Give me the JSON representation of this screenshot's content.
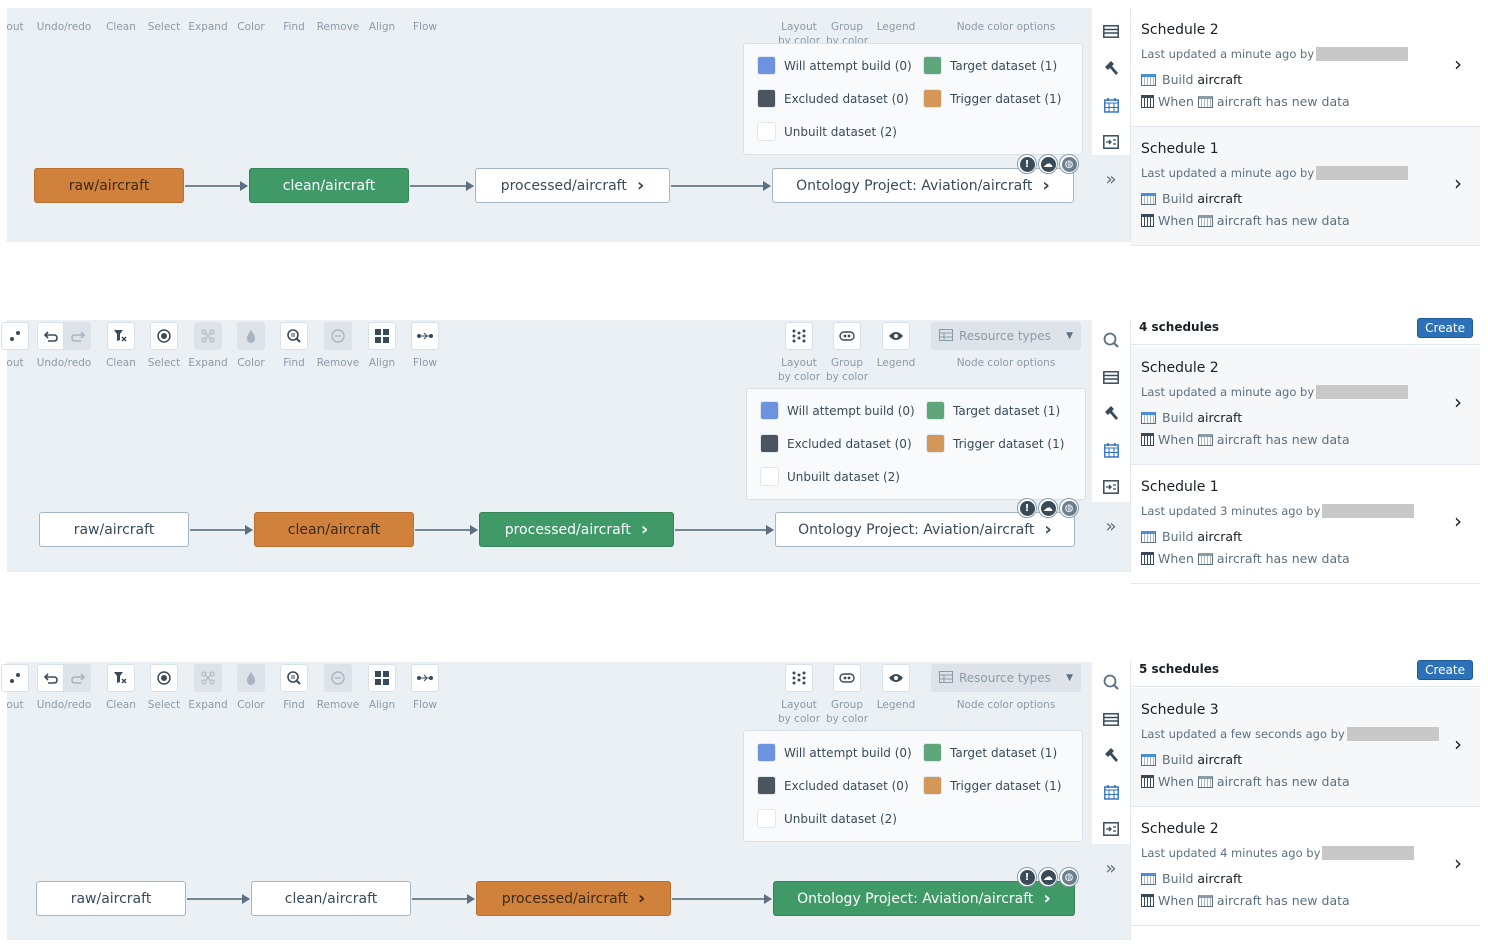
{
  "toolbar": {
    "items": [
      {
        "label": "Layout",
        "partial_label": "out",
        "icon": "layout-icon"
      },
      {
        "label": "Undo/redo",
        "icon": "undo-redo-icon"
      },
      {
        "label": "Clean",
        "icon": "clear-filter-icon"
      },
      {
        "label": "Select",
        "icon": "select-target-icon"
      },
      {
        "label": "Expand",
        "icon": "expand-graph-icon"
      },
      {
        "label": "Color",
        "icon": "color-drop-icon"
      },
      {
        "label": "Find",
        "icon": "search-zoom-icon"
      },
      {
        "label": "Remove",
        "icon": "remove-circle-icon"
      },
      {
        "label": "Align",
        "icon": "grid-align-icon"
      },
      {
        "label": "Flow",
        "icon": "flow-icon"
      }
    ],
    "right_items": [
      {
        "label_line1": "Layout",
        "label_line2": "by color",
        "icon": "layout-by-color-icon"
      },
      {
        "label_line1": "Group",
        "label_line2": "by color",
        "icon": "group-by-color-icon"
      },
      {
        "label_line1": "Legend",
        "label_line2": "",
        "icon": "eye-icon"
      }
    ],
    "node_color_select": {
      "value": "Resource types",
      "label": "Node color options"
    }
  },
  "legend": {
    "items": [
      {
        "label": "Will attempt build (0)",
        "color": "#6d93e0"
      },
      {
        "label": "Target dataset (1)",
        "color": "#5fa67c"
      },
      {
        "label": "Excluded dataset (0)",
        "color": "#4b5560"
      },
      {
        "label": "Trigger dataset (1)",
        "color": "#d59659"
      },
      {
        "label": "Unbuilt dataset (2)",
        "color": "#ffffff"
      }
    ]
  },
  "colors": {
    "trigger": "#d0813c",
    "target": "#3f9a68",
    "canvas_bg": "#ebf0f5",
    "create_button": "#2d72b8"
  },
  "panels": [
    {
      "nodes": [
        {
          "label": "raw/aircraft",
          "state": "trigger",
          "has_chevron": false
        },
        {
          "label": "clean/aircraft",
          "state": "target",
          "has_chevron": false
        },
        {
          "label": "processed/aircraft",
          "state": "unbuilt",
          "has_chevron": true
        },
        {
          "label": "Ontology Project: Aviation/aircraft",
          "state": "unbuilt",
          "has_chevron": true
        }
      ],
      "schedule_count": "",
      "schedules": [
        {
          "title": "Schedule 2",
          "updated": "Last updated a minute ago by",
          "build_prefix": "Build",
          "build_target": "aircraft",
          "when_prefix": "When",
          "when_text": "aircraft has new data"
        },
        {
          "title": "Schedule 1",
          "updated": "Last updated a minute ago by",
          "build_prefix": "Build",
          "build_target": "aircraft",
          "when_prefix": "When",
          "when_text": "aircraft has new data"
        }
      ]
    },
    {
      "nodes": [
        {
          "label": "raw/aircraft",
          "state": "unbuilt",
          "has_chevron": false
        },
        {
          "label": "clean/aircraft",
          "state": "trigger",
          "has_chevron": false
        },
        {
          "label": "processed/aircraft",
          "state": "target",
          "has_chevron": true
        },
        {
          "label": "Ontology Project: Aviation/aircraft",
          "state": "unbuilt",
          "has_chevron": true
        }
      ],
      "schedule_count": "4 schedules",
      "schedules": [
        {
          "title": "Schedule 2",
          "updated": "Last updated a minute ago by",
          "build_prefix": "Build",
          "build_target": "aircraft",
          "when_prefix": "When",
          "when_text": "aircraft has new data"
        },
        {
          "title": "Schedule 1",
          "updated": "Last updated 3 minutes ago by",
          "build_prefix": "Build",
          "build_target": "aircraft",
          "when_prefix": "When",
          "when_text": "aircraft has new data"
        }
      ]
    },
    {
      "nodes": [
        {
          "label": "raw/aircraft",
          "state": "unbuilt",
          "has_chevron": false
        },
        {
          "label": "clean/aircraft",
          "state": "unbuilt",
          "has_chevron": false
        },
        {
          "label": "processed/aircraft",
          "state": "trigger",
          "has_chevron": true
        },
        {
          "label": "Ontology Project: Aviation/aircraft",
          "state": "target",
          "has_chevron": true
        }
      ],
      "schedule_count": "5 schedules",
      "schedules": [
        {
          "title": "Schedule 3",
          "updated": "Last updated a few seconds ago by",
          "build_prefix": "Build",
          "build_target": "aircraft",
          "when_prefix": "When",
          "when_text": "aircraft has new data"
        },
        {
          "title": "Schedule 2",
          "updated": "Last updated 4 minutes ago by",
          "build_prefix": "Build",
          "build_target": "aircraft",
          "when_prefix": "When",
          "when_text": "aircraft has new data"
        }
      ]
    }
  ],
  "create_button": "Create",
  "glyphs": {
    "chevron": "›",
    "expand_rail": "»",
    "caret": "▼",
    "alert": "!",
    "cloud": "☁",
    "globe": "◍"
  }
}
